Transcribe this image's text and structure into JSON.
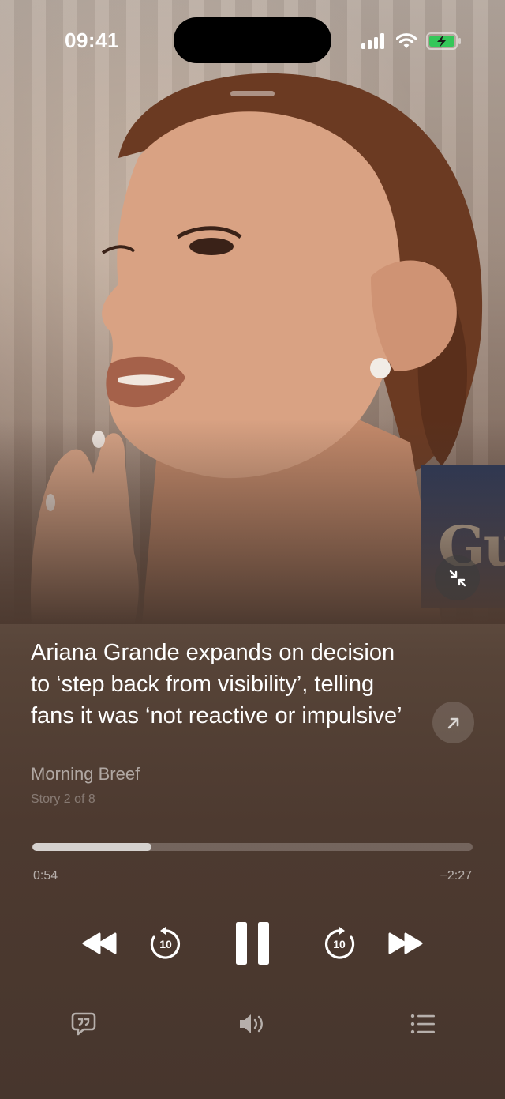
{
  "status_bar": {
    "time": "09:41"
  },
  "now_playing": {
    "title": "Ariana Grande expands on decision to ‘step back from visibility’, telling fans it was ‘not reactive or impulsive’",
    "source": "Morning Breef",
    "story_position": "Story 2 of 8",
    "side_card_text": "Gu"
  },
  "progress": {
    "elapsed": "0:54",
    "remaining": "−2:27",
    "fraction": 0.27
  },
  "controls": {
    "skip_back_seconds": "10",
    "skip_forward_seconds": "10",
    "state": "playing"
  },
  "icons": {
    "signal": "cellular-signal-icon",
    "wifi": "wifi-icon",
    "battery": "battery-charging-icon",
    "minimize": "minimize-icon",
    "share": "arrow-up-right-icon",
    "rewind": "rewind-icon",
    "skip_back": "skip-back-10-icon",
    "pause": "pause-icon",
    "skip_forward": "skip-forward-10-icon",
    "fast_forward": "fast-forward-icon",
    "transcript": "quote-bubble-icon",
    "volume": "speaker-icon",
    "queue": "list-icon"
  },
  "colors": {
    "battery_fill": "#34c759",
    "background": "#4d3a30"
  }
}
